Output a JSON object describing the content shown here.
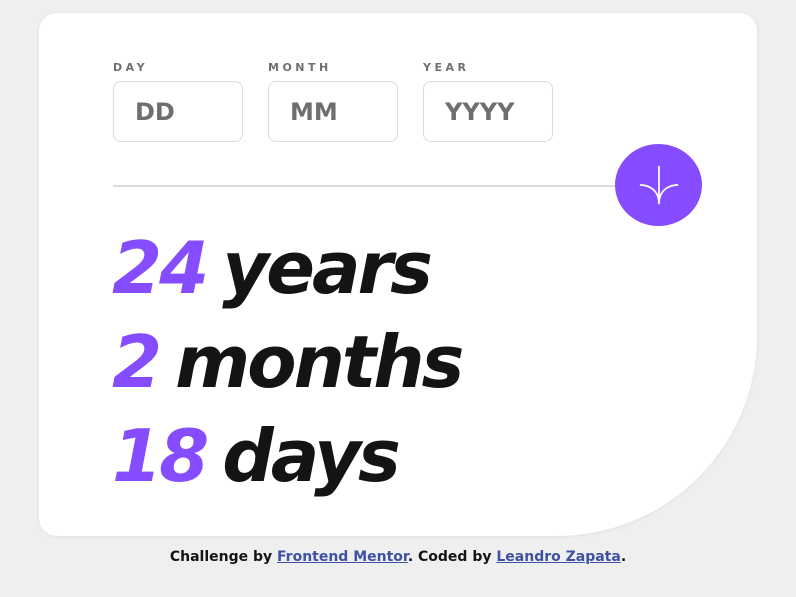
{
  "form": {
    "day": {
      "label": "DAY",
      "placeholder": "DD"
    },
    "month": {
      "label": "MONTH",
      "placeholder": "MM"
    },
    "year": {
      "label": "YEAR",
      "placeholder": "YYYY"
    },
    "submit_icon": "arrow-down-icon"
  },
  "results": [
    {
      "value": "24",
      "unit": "years"
    },
    {
      "value": "2",
      "unit": "months"
    },
    {
      "value": "18",
      "unit": "days"
    }
  ],
  "attribution": {
    "prefix": "Challenge by ",
    "link1": "Frontend Mentor",
    "middle": ". Coded by ",
    "link2": "Leandro Zapata",
    "suffix": "."
  },
  "colors": {
    "accent": "#854dff",
    "text": "#141414",
    "label": "#716f6f",
    "background": "#efefef",
    "card": "#ffffff",
    "link": "#3e52a3"
  }
}
